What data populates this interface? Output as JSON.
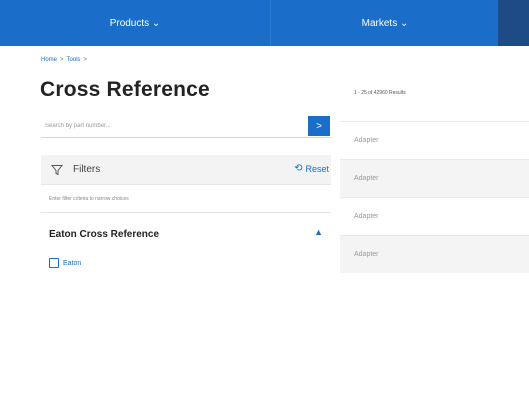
{
  "nav": {
    "products_label": "Products ⌄",
    "markets_label": "Markets ⌄"
  },
  "breadcrumb": {
    "home": "Home",
    "tools": "Tools",
    "sep": ">"
  },
  "page_title": "Cross Reference",
  "search": {
    "placeholder": "Search by part number...",
    "button_glyph": ">"
  },
  "filters": {
    "label": "Filters",
    "reset_label": "Reset",
    "hint": "Enter filter criteria to narrow choices"
  },
  "section": {
    "title": "Eaton Cross Reference",
    "chevron": "▲"
  },
  "checkbox": {
    "label": "Eaton"
  },
  "results": {
    "count_text": "1 - 25 of 42960 Results",
    "items": [
      "Adapter",
      "Adapter",
      "Adapter",
      "Adapter"
    ]
  },
  "colors": {
    "brand_blue": "#1a6dc9",
    "dark_nav": "#1e4a86"
  }
}
